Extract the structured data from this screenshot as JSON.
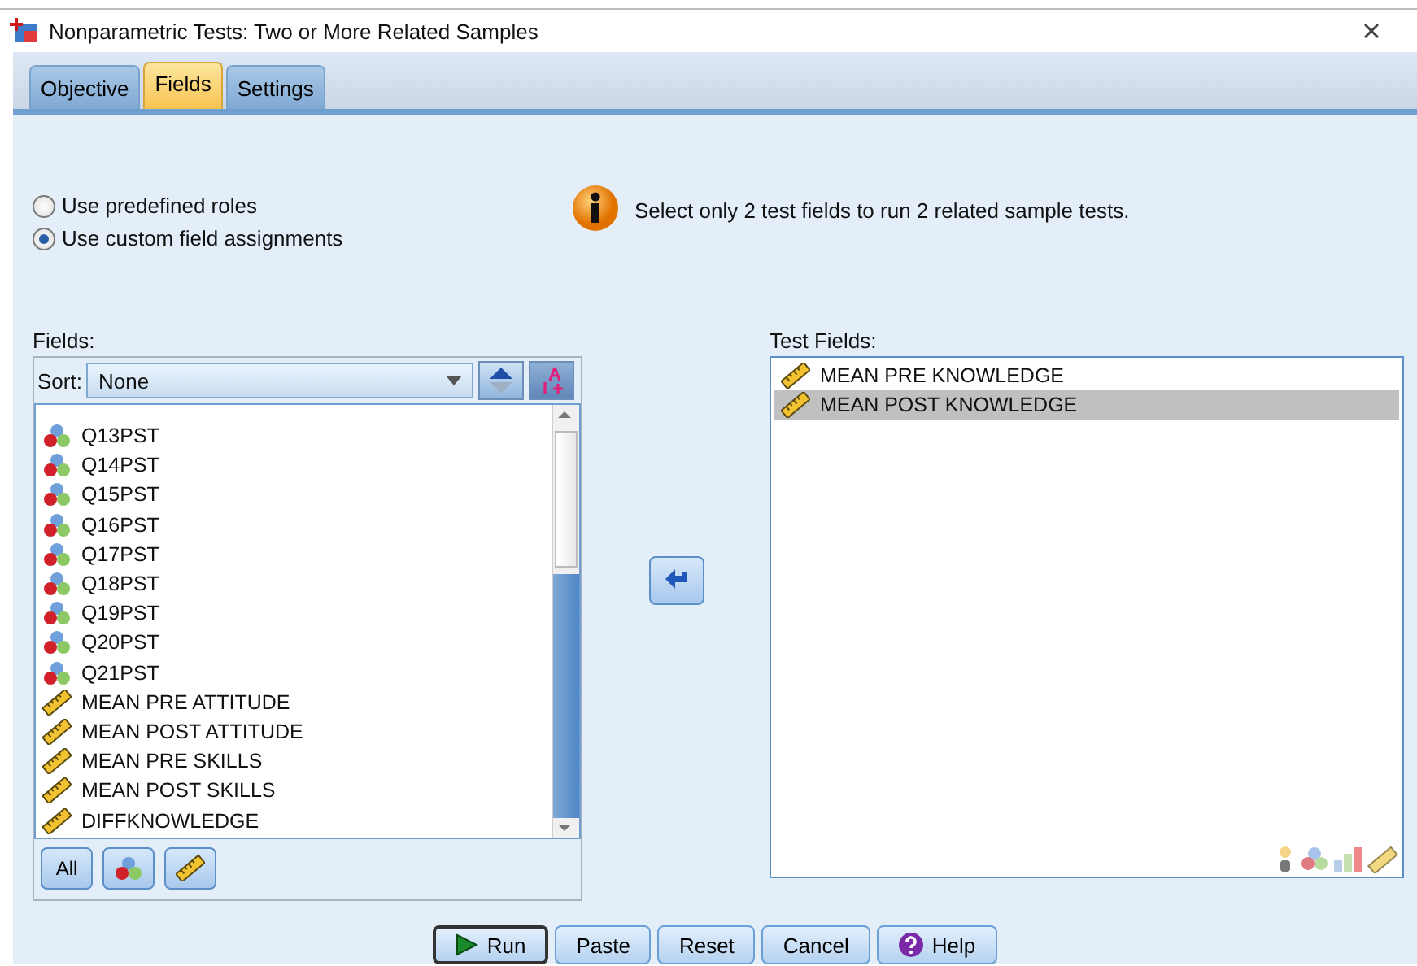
{
  "window": {
    "title": "Nonparametric Tests: Two or More Related Samples"
  },
  "tabs": [
    {
      "label": "Objective",
      "selected": false
    },
    {
      "label": "Fields",
      "selected": true
    },
    {
      "label": "Settings",
      "selected": false
    }
  ],
  "roles": [
    {
      "label": "Use predefined roles",
      "selected": false
    },
    {
      "label": "Use custom field assignments",
      "selected": true
    }
  ],
  "info": "Select only 2 test fields to run 2 related sample tests.",
  "fields": {
    "label": "Fields:",
    "sort_label": "Sort:",
    "sort_value": "None",
    "items": [
      {
        "name": "Q13PST",
        "kind": "nominal"
      },
      {
        "name": "Q14PST",
        "kind": "nominal"
      },
      {
        "name": "Q15PST",
        "kind": "nominal"
      },
      {
        "name": "Q16PST",
        "kind": "nominal"
      },
      {
        "name": "Q17PST",
        "kind": "nominal"
      },
      {
        "name": "Q18PST",
        "kind": "nominal"
      },
      {
        "name": "Q19PST",
        "kind": "nominal"
      },
      {
        "name": "Q20PST",
        "kind": "nominal"
      },
      {
        "name": "Q21PST",
        "kind": "nominal"
      },
      {
        "name": "MEAN PRE ATTITUDE",
        "kind": "scale"
      },
      {
        "name": "MEAN POST ATTITUDE",
        "kind": "scale"
      },
      {
        "name": "MEAN PRE SKILLS",
        "kind": "scale"
      },
      {
        "name": "MEAN POST SKILLS",
        "kind": "scale"
      },
      {
        "name": "DIFFKNOWLEDGE",
        "kind": "scale"
      }
    ],
    "filter_all": "All"
  },
  "test_fields": {
    "label": "Test Fields:",
    "items": [
      {
        "name": "MEAN PRE KNOWLEDGE",
        "kind": "scale",
        "selected": false
      },
      {
        "name": "MEAN POST KNOWLEDGE",
        "kind": "scale",
        "selected": true
      }
    ]
  },
  "buttons": [
    {
      "label": "Run",
      "kind": "run"
    },
    {
      "label": "Paste",
      "kind": "plain"
    },
    {
      "label": "Reset",
      "kind": "plain"
    },
    {
      "label": "Cancel",
      "kind": "plain"
    },
    {
      "label": "Help",
      "kind": "help"
    }
  ]
}
